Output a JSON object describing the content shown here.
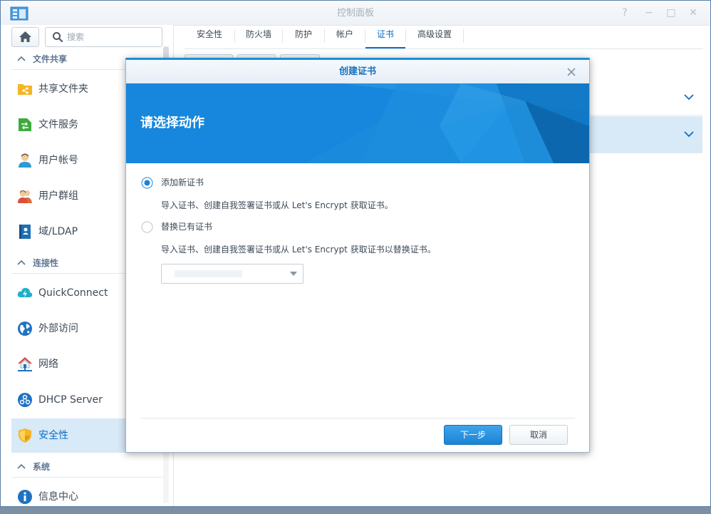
{
  "window": {
    "title": "控制面板"
  },
  "sidebar": {
    "search_placeholder": "搜索",
    "sections": [
      {
        "title": "文件共享",
        "items": [
          {
            "label": "共享文件夹",
            "icon": "shared-folder-icon"
          },
          {
            "label": "文件服务",
            "icon": "file-services-icon"
          },
          {
            "label": "用户帐号",
            "icon": "user-icon"
          },
          {
            "label": "用户群组",
            "icon": "group-icon"
          },
          {
            "label": "域/LDAP",
            "icon": "domain-ldap-icon"
          }
        ]
      },
      {
        "title": "连接性",
        "items": [
          {
            "label": "QuickConnect",
            "icon": "quickconnect-icon"
          },
          {
            "label": "外部访问",
            "icon": "external-access-icon"
          },
          {
            "label": "网络",
            "icon": "network-icon"
          },
          {
            "label": "DHCP Server",
            "icon": "dhcp-server-icon"
          },
          {
            "label": "安全性",
            "icon": "security-shield-icon",
            "active": true
          }
        ]
      },
      {
        "title": "系统",
        "items": [
          {
            "label": "信息中心",
            "icon": "info-icon"
          }
        ]
      }
    ]
  },
  "tabs": [
    {
      "label": "安全性"
    },
    {
      "label": "防火墙"
    },
    {
      "label": "防护"
    },
    {
      "label": "帐户"
    },
    {
      "label": "证书",
      "active": true
    },
    {
      "label": "高级设置"
    }
  ],
  "dialog": {
    "title": "创建证书",
    "banner_title": "请选择动作",
    "options": [
      {
        "label": "添加新证书",
        "description": "导入证书、创建自我签署证书或从 Let's Encrypt 获取证书。",
        "selected": true
      },
      {
        "label": "替换已有证书",
        "description": "导入证书、创建自我签署证书或从 Let's Encrypt 获取证书以替换证书。",
        "selected": false
      }
    ],
    "select_value": "",
    "next_label": "下一步",
    "cancel_label": "取消"
  },
  "colors": {
    "accent": "#0a6fc9",
    "banner": "#1687dc",
    "active_row": "#d8e9f7"
  }
}
